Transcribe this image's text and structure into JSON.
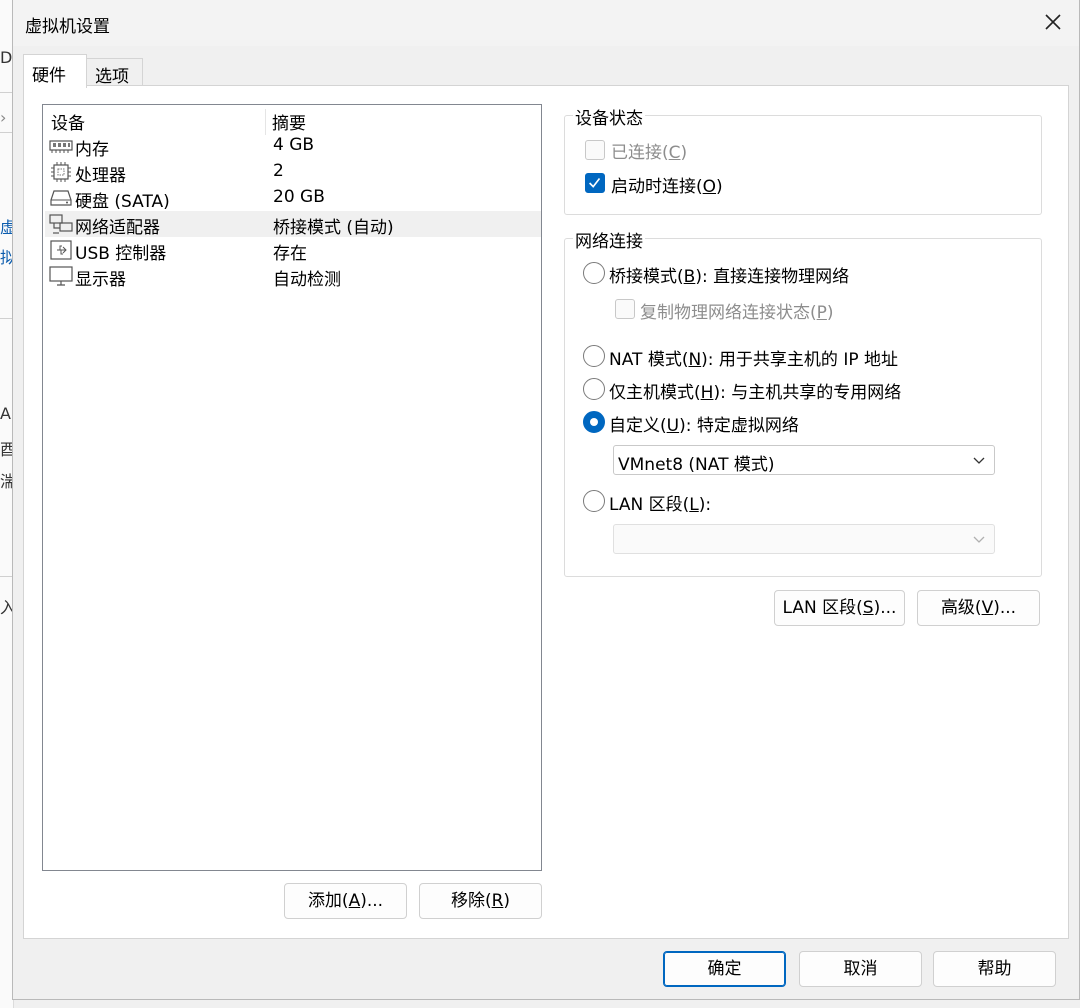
{
  "window": {
    "title": "虚拟机设置"
  },
  "tabs": [
    {
      "label": "硬件",
      "active": true
    },
    {
      "label": "选项",
      "active": false
    }
  ],
  "devices": {
    "col_device": "设备",
    "col_summary": "摘要",
    "rows": [
      {
        "name": "内存",
        "summary": "4 GB",
        "icon": "memory-icon",
        "selected": false
      },
      {
        "name": "处理器",
        "summary": "2",
        "icon": "cpu-icon",
        "selected": false
      },
      {
        "name": "硬盘 (SATA)",
        "summary": "20 GB",
        "icon": "hard-disk-icon",
        "selected": false
      },
      {
        "name": "网络适配器",
        "summary": "桥接模式 (自动)",
        "icon": "network-adapter-icon",
        "selected": true
      },
      {
        "name": "USB 控制器",
        "summary": "存在",
        "icon": "usb-icon",
        "selected": false
      },
      {
        "name": "显示器",
        "summary": "自动检测",
        "icon": "monitor-icon",
        "selected": false
      }
    ]
  },
  "list_buttons": {
    "add_pre": "添加(",
    "add_key": "A",
    "add_post": ")...",
    "remove_pre": "移除(",
    "remove_key": "R",
    "remove_post": ")"
  },
  "device_status": {
    "legend": "设备状态",
    "connected_pre": "已连接(",
    "connected_key": "C",
    "connected_post": ")",
    "connected_checked": false,
    "power_pre": "启动时连接(",
    "power_key": "O",
    "power_post": ")",
    "power_checked": true
  },
  "network": {
    "legend": "网络连接",
    "bridged_pre": "桥接模式(",
    "bridged_key": "B",
    "bridged_post": "): 直接连接物理网络",
    "replicate_pre": "复制物理网络连接状态(",
    "replicate_key": "P",
    "replicate_post": ")",
    "nat_pre": "NAT 模式(",
    "nat_key": "N",
    "nat_post": "): 用于共享主机的 IP 地址",
    "hostonly_pre": "仅主机模式(",
    "hostonly_key": "H",
    "hostonly_post": "): 与主机共享的专用网络",
    "custom_pre": "自定义(",
    "custom_key": "U",
    "custom_post": "): 特定虚拟网络",
    "custom_selected_value": "VMnet8 (NAT 模式)",
    "lan_pre": "LAN 区段(",
    "lan_key": "L",
    "lan_post": "):",
    "lan_selected_value": "",
    "selected": "custom"
  },
  "net_buttons": {
    "lan_pre": "LAN 区段(",
    "lan_key": "S",
    "lan_post": ")...",
    "adv_pre": "高级(",
    "adv_key": "V",
    "adv_post": ")..."
  },
  "footer": {
    "ok": "确定",
    "cancel": "取消",
    "help": "帮助"
  },
  "background_fragments": [
    "D)",
    "虚",
    "拟",
    "A",
    "酉",
    "湍",
    "入"
  ],
  "colors": {
    "accent": "#0067c0"
  }
}
